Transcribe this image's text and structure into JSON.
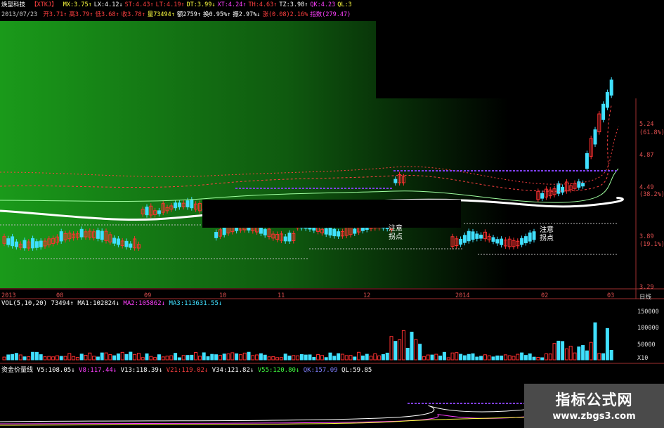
{
  "window": {
    "date": "2013/07/23"
  },
  "quote_row1": {
    "name": "焕型科技",
    "code": "【XTKJ】",
    "items": [
      "MX:3.75↑",
      "LX:4.12↓",
      "ST:4.43↑",
      "LT:4.19↑",
      "DT:3.99↓",
      "XT:4.24↑",
      "TH:4.63↑",
      "TZ:3.98↑",
      "QK:4.23",
      "QL:3"
    ]
  },
  "quote_row2": {
    "items": [
      "开3.71↑",
      "高3.79↑",
      "低3.68↑",
      "收3.78↑",
      "量73494↑",
      "额2759↑",
      "换0.95%↑",
      "振2.97%↓",
      "涨(0.08)2.16%",
      "指数(279.47)"
    ]
  },
  "price_axis": {
    "labels": [
      "5.24",
      "(61.8%)",
      "4.87",
      "4.49",
      "(38.2%)",
      "3.89",
      "(19.1%)",
      "3.29"
    ]
  },
  "date_axis": {
    "labels": [
      "2013",
      "08",
      "09",
      "10",
      "11",
      "12",
      "2014",
      "02",
      "03"
    ],
    "period_label": "日线"
  },
  "volume_panel": {
    "header": [
      "VOL(5,10,20)",
      "73494↑",
      "MA1:102824↓",
      "MA2:105862↓",
      "MA3:113631.55↓"
    ],
    "axis_labels": [
      "150000",
      "100000",
      "50000",
      "X10"
    ]
  },
  "fund_panel": {
    "header": [
      "资金价量线",
      "V5:108.05↓",
      "V8:117.44↓",
      "V13:118.39↓",
      "V21:119.02↓",
      "V34:121.82↓",
      "V55:120.80↓",
      "QK:157.09",
      "QL:59.85"
    ]
  },
  "annotations": {
    "note1": "注意\n拐点",
    "note2": "注意\n拐点"
  },
  "watermark": {
    "line1": "指标公式网",
    "line2": "www.zbgs3.com"
  },
  "colors": {
    "up": "#ff3030",
    "down": "#40e0ff",
    "gradient_start": "#1a8c1a",
    "support_line": "#9a9a9a",
    "resistance_line": "#8040ff"
  }
}
